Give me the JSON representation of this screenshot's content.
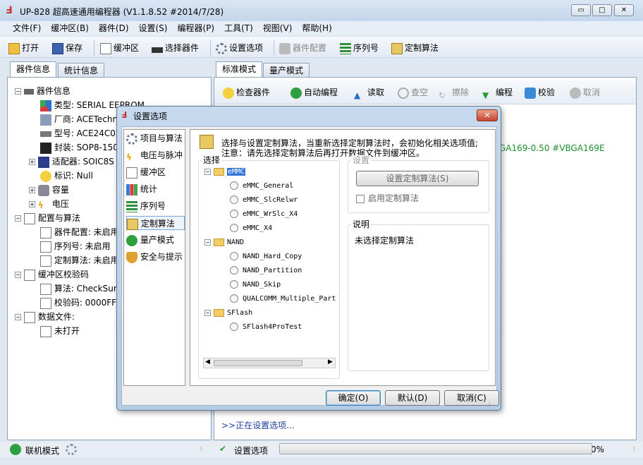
{
  "window": {
    "title": "UP-828 超高速通用编程器  (V1.1.8.52 #2014/7/28)",
    "min": "▭",
    "max": "□",
    "close": "✕"
  },
  "menu": [
    "文件(F)",
    "缓冲区(B)",
    "器件(D)",
    "设置(S)",
    "编程器(P)",
    "工具(T)",
    "视图(V)",
    "帮助(H)"
  ],
  "toolbar": {
    "open": "打开",
    "save": "保存",
    "buffer": "缓冲区",
    "select_device": "选择器件",
    "settings": "设置选项",
    "device_config": "器件配置",
    "serial": "序列号",
    "custom_algo": "定制算法"
  },
  "left": {
    "tabs": [
      "器件信息",
      "统计信息"
    ],
    "tree": {
      "device_info": "器件信息",
      "type": "类型: SERIAL EEPROM",
      "vendor": "厂商: ACETechn",
      "model": "型号: ACE24C02",
      "package": "封装: SOP8-150",
      "adapter": "适配器: SOIC8S",
      "mark": "标识: Null",
      "capacity": "容量",
      "voltage": "电压",
      "config": "配置与算法",
      "dev_config": "器件配置: 未启用",
      "serial": "序列号: 未启用",
      "custom": "定制算法: 未启用",
      "checksum": "缓冲区校验码",
      "algo": "算法: CheckSum",
      "code": "校验码: 0000FFC",
      "datafile": "数据文件:",
      "notopen": "未打开"
    }
  },
  "right": {
    "tabs": [
      "标准模式",
      "量产模式"
    ],
    "toolbar": {
      "check": "检查器件",
      "auto": "自动编程",
      "read": "读取",
      "blank": "查空",
      "erase": "擦除",
      "program": "编程",
      "verify": "校验",
      "cancel": "取消"
    },
    "green_text": "GA169-0.50 #VBGA169E",
    "log": ">>正在设置选项..."
  },
  "status": {
    "mode": "联机模式",
    "task": "设置选项",
    "progress": "0%",
    "progress_value": 0
  },
  "dialog": {
    "title": "设置选项",
    "nav": [
      "项目与算法",
      "电压与脉冲",
      "缓冲区",
      "统计",
      "序列号",
      "定制算法",
      "量产模式",
      "安全与提示"
    ],
    "desc_line1": "选择与设置定制算法，当重新选择定制算法时，会初始化相关选项值;",
    "desc_line2": "注意：请先选择定制算法后再打开数据文件到缓冲区。",
    "select_label": "选择",
    "settings_label": "设置",
    "settings_button": "设置定制算法(S)",
    "enable_label": "启用定制算法",
    "explain_label": "说明",
    "explain_text": "未选择定制算法",
    "folders": {
      "emmc": {
        "name": "eMMC",
        "items": [
          "eMMC_General",
          "eMMC_SlcRelwr",
          "eMMC_WrSlc_X4",
          "eMMC_X4"
        ]
      },
      "nand": {
        "name": "NAND",
        "items": [
          "NAND_Hard_Copy",
          "NAND_Partition",
          "NAND_Skip",
          "QUALCOMM_Multiple_Part"
        ]
      },
      "sflash": {
        "name": "SFlash",
        "items": [
          "SFlash4ProTest"
        ]
      }
    },
    "ok": "确定(O)",
    "default": "默认(D)",
    "cancel": "取消(C)"
  }
}
